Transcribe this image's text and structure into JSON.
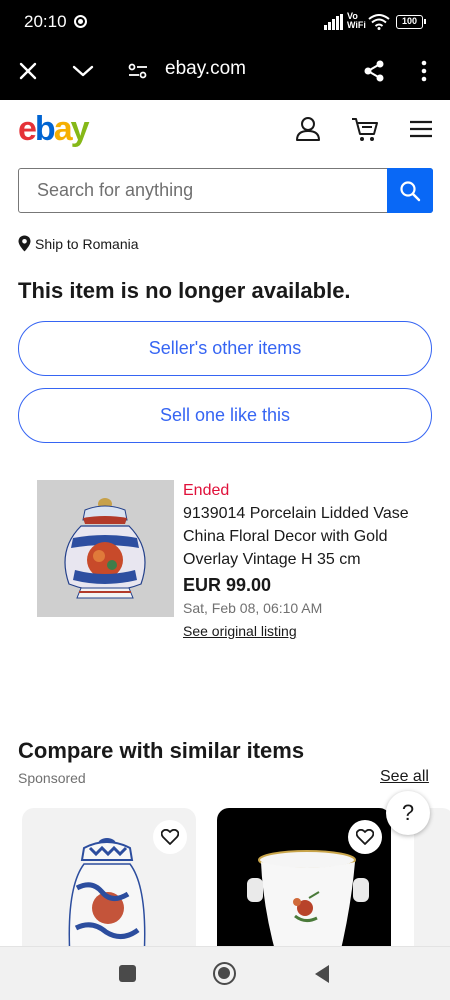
{
  "status_bar": {
    "time": "20:10",
    "network_label": "Vo WiFi",
    "battery": "100"
  },
  "browser": {
    "url": "ebay.com"
  },
  "header": {
    "logo_letters": [
      "e",
      "b",
      "a",
      "y"
    ],
    "logo_colors": [
      "#e53238",
      "#0064d2",
      "#f5af02",
      "#86b817"
    ]
  },
  "search": {
    "placeholder": "Search for anything",
    "value": ""
  },
  "shipping": {
    "label": "Ship to Romania"
  },
  "notice": {
    "title": "This item is no longer available."
  },
  "actions": {
    "sellers_other_items": "Seller's other items",
    "sell_one_like_this": "Sell one like this"
  },
  "listing": {
    "status": "Ended",
    "title": "9139014 Porcelain Lidded Vase China Floral Decor with Gold Overlay Vintage H 35 cm",
    "price": "EUR 99.00",
    "date": "Sat, Feb 08, 06:10 AM",
    "link": "See original listing"
  },
  "similar": {
    "title": "Compare with similar items",
    "sponsored": "Sponsored",
    "see_all": "See all"
  },
  "help": {
    "label": "?"
  },
  "colors": {
    "accent_blue": "#3665f3",
    "search_blue": "#0968f6",
    "ended_red": "#e0103a"
  }
}
